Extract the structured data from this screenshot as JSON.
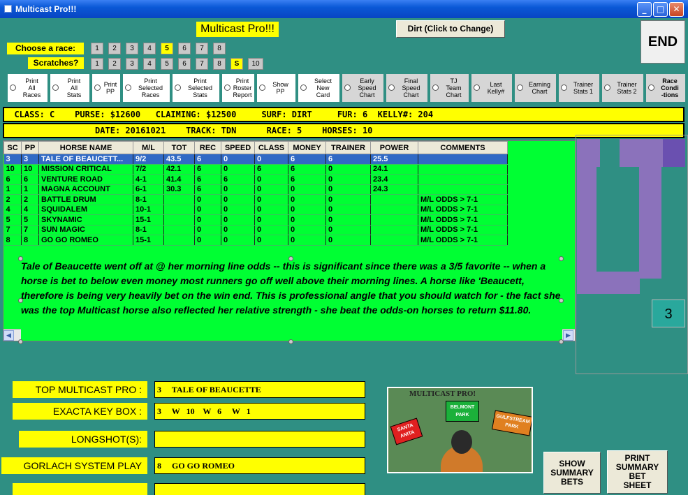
{
  "window": {
    "title": "Multicast Pro!!!"
  },
  "header": {
    "app_label": "Multicast Pro!!!",
    "surface_button": "Dirt (Click to Change)",
    "end_button": "END"
  },
  "race_picker": {
    "label": "Choose  a race:",
    "buttons": [
      "1",
      "2",
      "3",
      "4",
      "5",
      "6",
      "7",
      "8"
    ],
    "selected": "5"
  },
  "scratches": {
    "label": "Scratches?",
    "buttons": [
      "1",
      "2",
      "3",
      "4",
      "5",
      "6",
      "7",
      "8",
      "S",
      "10"
    ],
    "selected": "S"
  },
  "options": [
    {
      "label": "Print\nAll\nRaces"
    },
    {
      "label": "Print\nAll\nStats"
    },
    {
      "label": "Print\nPP"
    },
    {
      "label": "Print\nSelected\nRaces"
    },
    {
      "label": "Print\nSelected\nStats"
    },
    {
      "label": "Print\nRoster\nReport"
    },
    {
      "label": "Show\nPP"
    },
    {
      "label": "Select\nNew\nCard"
    },
    {
      "label": "Early\nSpeed\nChart"
    },
    {
      "label": "Final\nSpeed\nChart"
    },
    {
      "label": "TJ\nTeam\nChart"
    },
    {
      "label": "Last\nKelly#"
    },
    {
      "label": "Earning\nChart"
    },
    {
      "label": "Trainer\nStats 1"
    },
    {
      "label": "Trainer\nStats 2"
    },
    {
      "label": "Race\nCondi\n-tions"
    }
  ],
  "race_info": {
    "line1": "  CLASS: C    PURSE: $12600   CLAIMING: $12500     SURF: DIRT     FUR: 6  KELLY#: 204",
    "line2": "                  DATE: 20161021    TRACK: TDN      RACE: 5    HORSES: 10"
  },
  "table": {
    "columns": [
      "SC",
      "PP",
      "HORSE NAME",
      "M/L",
      "TOT",
      "REC",
      "SPEED",
      "CLASS",
      "MONEY",
      "TRAINER",
      "POWER",
      "COMMENTS"
    ],
    "rows": [
      [
        "3",
        "3",
        "TALE OF BEAUCETT...",
        "9/2",
        "43.5",
        "6",
        "0",
        "0",
        "6",
        "6",
        "25.5",
        ""
      ],
      [
        "10",
        "10",
        "MISSION CRITICAL",
        "7/2",
        "42.1",
        "6",
        "0",
        "6",
        "6",
        "0",
        "24.1",
        ""
      ],
      [
        "6",
        "6",
        "VENTURE ROAD",
        "4-1",
        "41.4",
        "6",
        "6",
        "0",
        "6",
        "0",
        "23.4",
        ""
      ],
      [
        "1",
        "1",
        "MAGNA ACCOUNT",
        "6-1",
        "30.3",
        "6",
        "0",
        "0",
        "0",
        "0",
        "24.3",
        ""
      ],
      [
        "2",
        "2",
        "BATTLE DRUM",
        "8-1",
        "",
        "0",
        "0",
        "0",
        "0",
        "0",
        "",
        "M/L ODDS > 7-1"
      ],
      [
        "4",
        "4",
        "SQUIDALEM",
        "10-1",
        "",
        "0",
        "0",
        "0",
        "0",
        "0",
        "",
        "M/L ODDS > 7-1"
      ],
      [
        "5",
        "5",
        "SKYNAMIC",
        "15-1",
        "",
        "0",
        "0",
        "0",
        "0",
        "0",
        "",
        "M/L ODDS > 7-1"
      ],
      [
        "7",
        "7",
        "SUN MAGIC",
        "8-1",
        "",
        "0",
        "0",
        "0",
        "0",
        "0",
        "",
        "M/L ODDS > 7-1"
      ],
      [
        "8",
        "8",
        "GO GO ROMEO",
        "15-1",
        "",
        "0",
        "0",
        "0",
        "0",
        "0",
        "",
        "M/L ODDS > 7-1"
      ]
    ]
  },
  "commentary": "Tale of Beaucette went off at @ her morning line odds -- this is significant since there was a 3/5 favorite -- when a horse is bet to below even money most runners go off well above their morning lines.  A horse like 'Beaucett, therefore is being very heavily bet on the win end. This is professional angle that you should watch for - the fact she was the top Multicast horse also reflected her relative strength - she beat the odds-on horses to return $11.80.",
  "side_number": "3",
  "summary": {
    "top_label": "TOP MULTICAST PRO :",
    "top_value": "3     TALE OF BEAUCETTE",
    "exacta_label": "EXACTA KEY BOX :",
    "exacta_value": "3     W   10    W   6     W   1",
    "longshot_label": "LONGSHOT(S):",
    "longshot_value": "",
    "gorlach_label": "GORLACH SYSTEM PLAY",
    "gorlach_value": "8     GO GO ROMEO",
    "extra_label": "",
    "extra_value": ""
  },
  "logo": {
    "title": "MULTICAST PRO!",
    "cards": [
      "BELMONT\nPARK",
      "SANTA\nANITA",
      "GULFSTREAM\nPARK"
    ]
  },
  "buttons": {
    "show_summary": "SHOW\nSUMMARY\nBETS",
    "print_summary": "PRINT\nSUMMARY\nBET\nSHEET"
  },
  "colors": {
    "accent": "#ffff00",
    "grid": "#00ff33",
    "background": "#2f8f83",
    "selected_row": "#316ac5"
  }
}
